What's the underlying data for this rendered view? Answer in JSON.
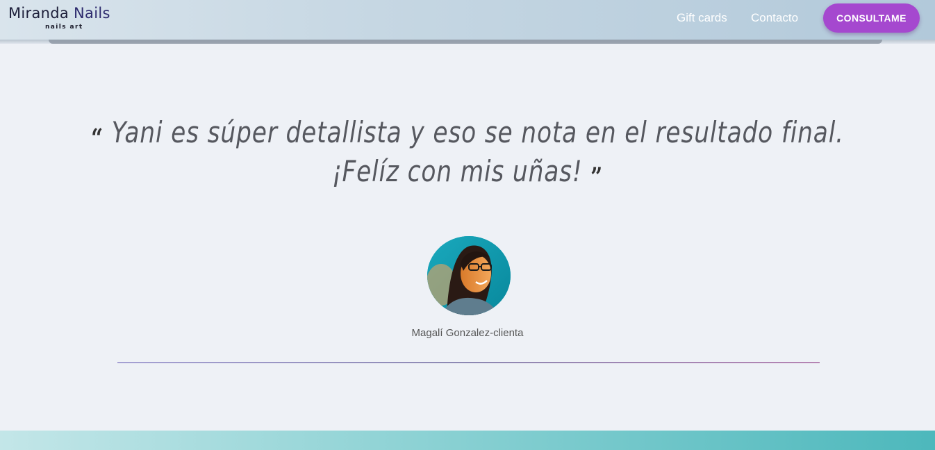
{
  "header": {
    "logo_main_1": "Miranda ",
    "logo_main_2": "Nails",
    "logo_sub": "nails art",
    "nav": {
      "gift_cards": "Gift cards",
      "contacto": "Contacto"
    },
    "cta_label": "CONSULTAME"
  },
  "testimonial": {
    "open_mark": "“",
    "close_mark": "”",
    "quote_line_1": "Yani es súper detallista y eso se nota en el resultado final.",
    "quote_line_2": "¡Felíz con mis uñas!",
    "author": "Magalí Gonzalez-clienta",
    "avatar_icon": "person-avatar"
  },
  "colors": {
    "cta": "#a548cf",
    "footer_band": "#4db8bc",
    "background": "#eef1f6"
  }
}
